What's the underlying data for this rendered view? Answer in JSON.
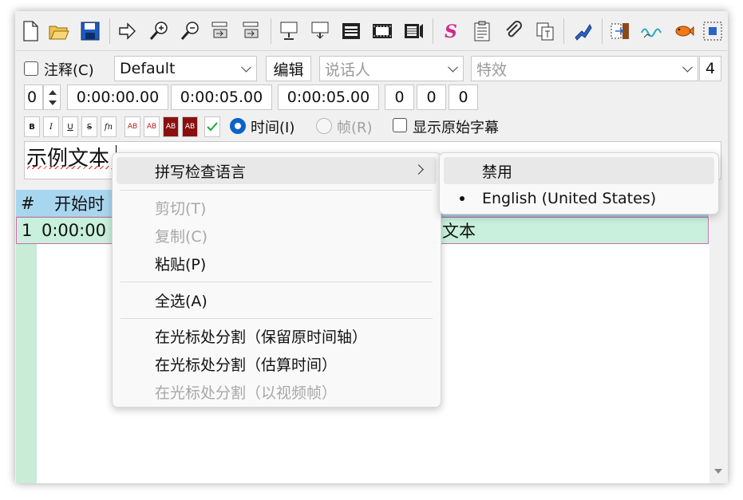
{
  "toolbar": {
    "buttons": [
      "new-icon",
      "open-icon",
      "save-icon",
      "arrow-right-icon",
      "zoom-in-icon",
      "zoom-out-icon",
      "shift-timing-icon",
      "shift-timing-2-icon",
      "insert-above-icon",
      "insert-below-icon",
      "film-icon",
      "film-strip-icon",
      "video-icon",
      "styles-icon",
      "notes-icon",
      "attachments-icon",
      "resample-icon",
      "automation-icon",
      "import-icon",
      "audio-wave-icon",
      "fish-icon",
      "select-frame-icon"
    ]
  },
  "edit": {
    "comment_label": "注释(C)",
    "style_value": "Default",
    "edit_button": "编辑",
    "actor_placeholder": "说话人",
    "effect_placeholder": "特效",
    "margin_layer_value": "4",
    "layer_value": "0",
    "start_time": "0:00:00.00",
    "end_time": "0:00:05.00",
    "duration": "0:00:05.00",
    "margin_l": "0",
    "margin_r": "0",
    "margin_v": "0",
    "fmt_buttons": [
      "B",
      "I",
      "U",
      "S",
      "fn",
      "AB",
      "AB",
      "AB",
      "AB"
    ],
    "commit_icon": "check-icon",
    "radio_time": "时间(I)",
    "radio_frame": "帧(R)",
    "show_original": "显示原始字幕",
    "text": "示例文本"
  },
  "grid": {
    "headers": [
      "#",
      "开始时"
    ],
    "rows": [
      {
        "num": "1",
        "start": "0:00:00",
        "text": "文本"
      }
    ]
  },
  "context_menu": {
    "spell_lang": "拼写检查语言",
    "cut": "剪切(T)",
    "copy": "复制(C)",
    "paste": "粘贴(P)",
    "select_all": "全选(A)",
    "split_keep": "在光标处分割（保留原时间轴）",
    "split_estimate": "在光标处分割（估算时间）",
    "split_video": "在光标处分割（以视频帧）"
  },
  "submenu": {
    "disable": "禁用",
    "english": "English (United States)"
  },
  "colors": {
    "accent": "#0a64c8",
    "grid_header": "#a9d6ef",
    "row_bg": "#c8f0dc"
  }
}
